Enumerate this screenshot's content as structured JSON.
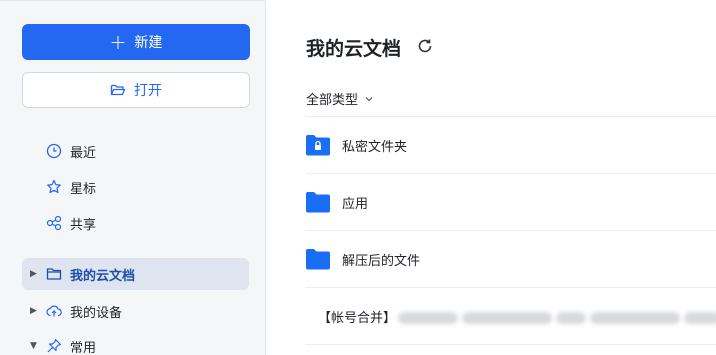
{
  "sidebar": {
    "new_label": "新建",
    "open_label": "打开",
    "nav": [
      {
        "label": "最近",
        "icon": "clock-icon"
      },
      {
        "label": "星标",
        "icon": "star-icon"
      },
      {
        "label": "共享",
        "icon": "share-icon"
      }
    ],
    "tree": [
      {
        "label": "我的云文档",
        "icon": "folder-icon",
        "active": true
      },
      {
        "label": "我的设备",
        "icon": "cloud-upload-icon",
        "active": false
      },
      {
        "label": "常用",
        "icon": "pin-icon",
        "active": false
      }
    ]
  },
  "main": {
    "title": "我的云文档",
    "filter_label": "全部类型",
    "files": [
      {
        "name": "私密文件夹",
        "icon": "locked-folder-icon"
      },
      {
        "name": "应用",
        "icon": "folder-icon"
      },
      {
        "name": "解压后的文件",
        "icon": "folder-icon"
      },
      {
        "name_prefix": "【帐号合并】",
        "name_suffix": "5",
        "icon": "folder-icon"
      }
    ]
  },
  "colors": {
    "accent": "#2468f2",
    "folder": "#1a6ef5",
    "sidebar_bg": "#f5f6f7",
    "active_bg": "#dfe5f0"
  }
}
